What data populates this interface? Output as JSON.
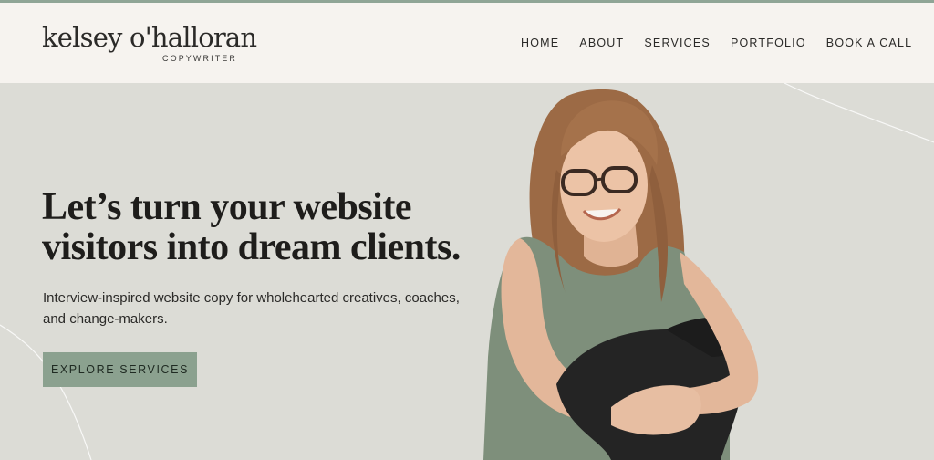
{
  "brand": {
    "name": "kelsey o'halloran",
    "tagline": "COPYWRITER"
  },
  "nav": {
    "items": [
      {
        "label": "HOME"
      },
      {
        "label": "ABOUT"
      },
      {
        "label": "SERVICES"
      },
      {
        "label": "PORTFOLIO"
      },
      {
        "label": "BOOK A CALL"
      }
    ]
  },
  "hero": {
    "headline_line1": "Let’s turn your website",
    "headline_line2": "visitors into dream clients.",
    "subtext": "Interview-inspired website copy for wholehearted creatives, coaches, and change-makers.",
    "cta_label": "EXPLORE SERVICES"
  },
  "colors": {
    "accent": "#8ba18f",
    "header_bg": "#f6f3ef",
    "hero_bg": "#dcdcd6",
    "text_dark": "#1e1d1b",
    "top_bar": "#8fa596"
  },
  "icons": [
    "portrait-photo"
  ]
}
